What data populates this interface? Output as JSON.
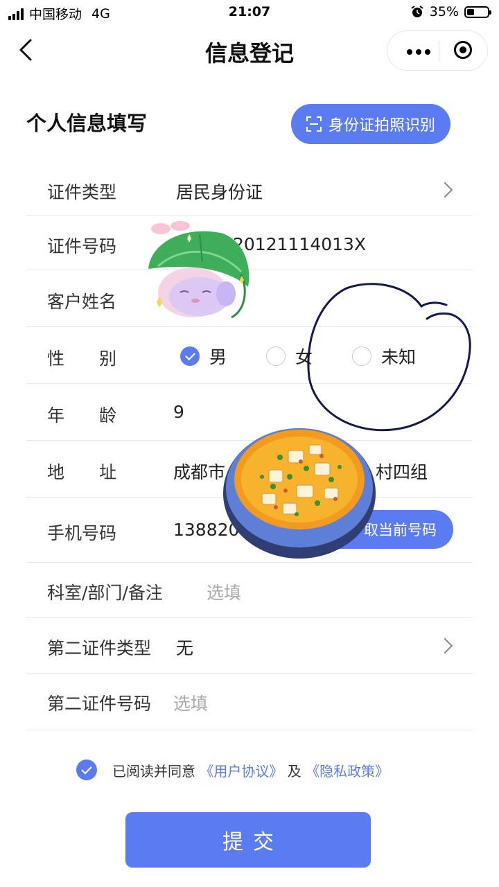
{
  "status_bar": {
    "carrier": "中国移动",
    "network": "4G",
    "time": "21:07",
    "battery": "35%",
    "alarm_icon": "alarm-clock-icon"
  },
  "nav": {
    "title": "信息登记",
    "back_icon": "chevron-left-icon",
    "more_icon": "more-dots-icon",
    "close_icon": "target-circle-icon"
  },
  "section": {
    "title": "个人信息填写",
    "scan_button": "身份证拍照识别"
  },
  "form": {
    "id_type": {
      "label": "证件类型",
      "value": "居民身份证"
    },
    "id_number": {
      "label": "证件号码",
      "value": "20121114013X"
    },
    "name": {
      "label": "客户姓名",
      "value": ""
    },
    "gender": {
      "label": "性　　别",
      "options": [
        "男",
        "女",
        "未知"
      ],
      "selected": "男"
    },
    "age": {
      "label": "年　　龄",
      "value": "9"
    },
    "address": {
      "label": "地　　址",
      "value_start": "成都市",
      "value_end": "村四组"
    },
    "phone": {
      "label": "手机号码",
      "value": "138820",
      "button": "取当前号码"
    },
    "dept": {
      "label": "科室/部门/备注",
      "placeholder": "选填"
    },
    "second_id_type": {
      "label": "第二证件类型",
      "value": "无"
    },
    "second_id_number": {
      "label": "第二证件号码",
      "placeholder": "选填"
    }
  },
  "agreement": {
    "checked": true,
    "text": "已阅读并同意",
    "user_agreement": "《用户协议》",
    "and": "及",
    "privacy_policy": "《隐私政策》"
  },
  "submit_label": "提交",
  "colors": {
    "accent": "#5b7cf0",
    "text": "#222222",
    "placeholder": "#aaaaaa",
    "divider": "#e8e8e8"
  }
}
